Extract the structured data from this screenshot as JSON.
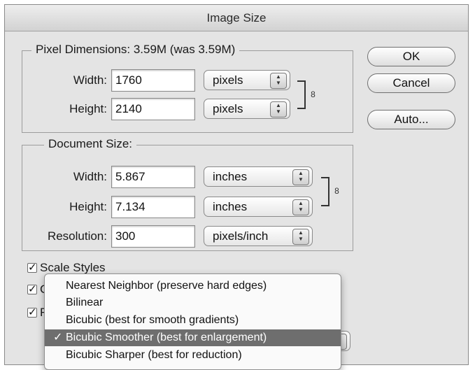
{
  "window": {
    "title": "Image Size"
  },
  "pixel_dimensions": {
    "legend": "Pixel Dimensions:  3.59M (was 3.59M)",
    "width_label": "Width:",
    "width_value": "1760",
    "width_unit": "pixels",
    "height_label": "Height:",
    "height_value": "2140",
    "height_unit": "pixels"
  },
  "document_size": {
    "legend": "Document Size:",
    "width_label": "Width:",
    "width_value": "5.867",
    "width_unit": "inches",
    "height_label": "Height:",
    "height_value": "7.134",
    "height_unit": "inches",
    "resolution_label": "Resolution:",
    "resolution_value": "300",
    "resolution_unit": "pixels/inch"
  },
  "buttons": {
    "ok": "OK",
    "cancel": "Cancel",
    "auto": "Auto..."
  },
  "checkboxes": {
    "scale_styles": "Scale Styles",
    "second_visible": "C",
    "third_visible": "R"
  },
  "resample_menu": {
    "items": [
      {
        "label": "Nearest Neighbor (preserve hard edges)",
        "selected": false
      },
      {
        "label": "Bilinear",
        "selected": false
      },
      {
        "label": "Bicubic (best for smooth gradients)",
        "selected": false
      },
      {
        "label": "Bicubic Smoother (best for enlargement)",
        "selected": true
      },
      {
        "label": "Bicubic Sharper (best for reduction)",
        "selected": false
      }
    ],
    "checkmark": "✓"
  },
  "colors": {
    "selection": "#6e6e6e",
    "dialog_bg": "#e4e4e4"
  }
}
